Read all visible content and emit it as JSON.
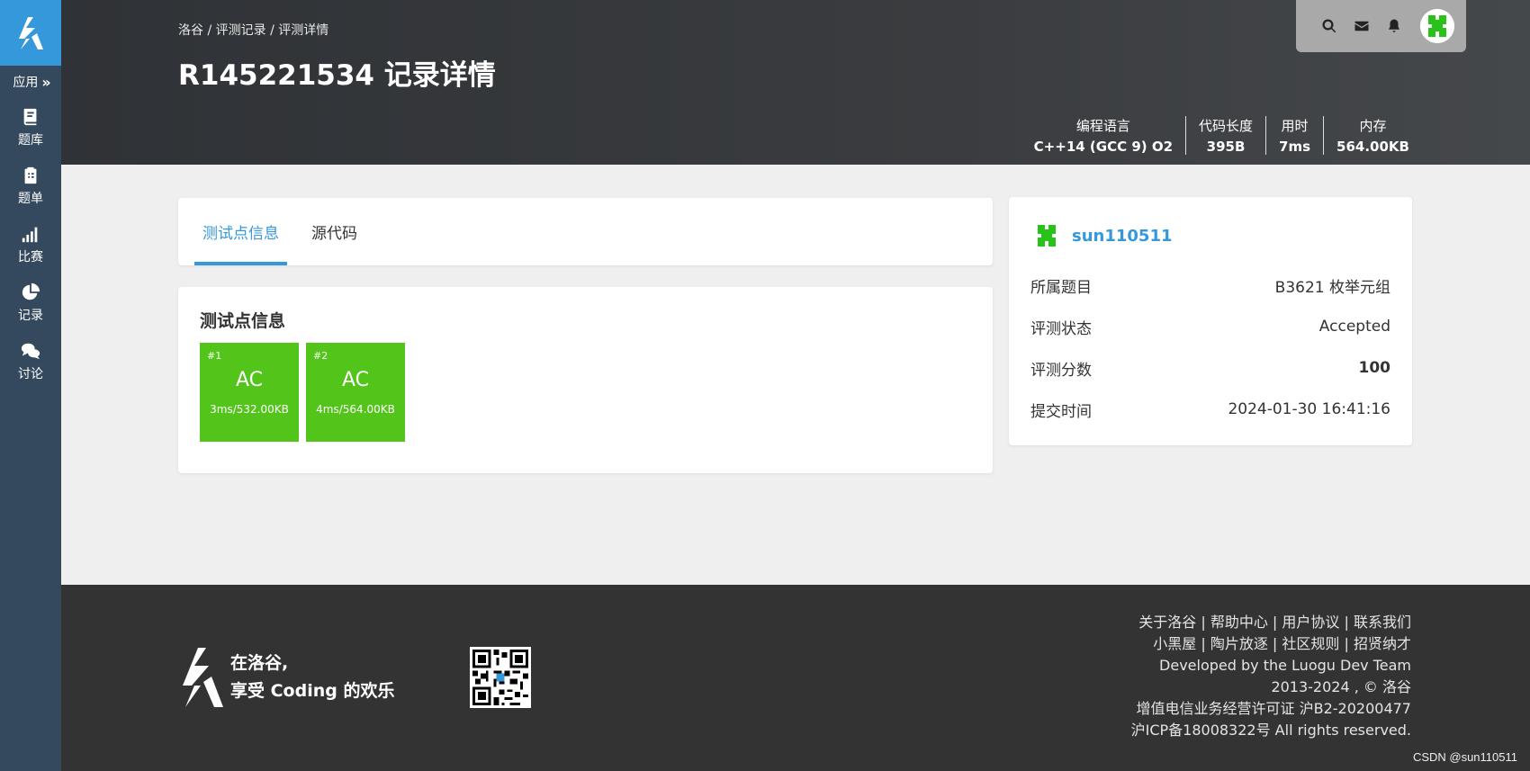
{
  "sidebar": {
    "apps_label": "应用",
    "items": [
      {
        "label": "题库",
        "icon": "book-icon"
      },
      {
        "label": "题单",
        "icon": "clipboard-icon"
      },
      {
        "label": "比赛",
        "icon": "signal-bars-icon"
      },
      {
        "label": "记录",
        "icon": "pie-chart-icon"
      },
      {
        "label": "讨论",
        "icon": "comments-icon"
      }
    ]
  },
  "header": {
    "breadcrumb": [
      "洛谷",
      "评测记录",
      "评测详情"
    ],
    "breadcrumb_sep": " / ",
    "title": "R145221534 记录详情",
    "stats": [
      {
        "label": "编程语言",
        "value": "C++14 (GCC 9) O2"
      },
      {
        "label": "代码长度",
        "value": "395B"
      },
      {
        "label": "用时",
        "value": "7ms"
      },
      {
        "label": "内存",
        "value": "564.00KB"
      }
    ]
  },
  "tabs": [
    "测试点信息",
    "源代码"
  ],
  "tests": {
    "heading": "测试点信息",
    "cases": [
      {
        "num": "#1",
        "result": "AC",
        "meta": "3ms/532.00KB"
      },
      {
        "num": "#2",
        "result": "AC",
        "meta": "4ms/564.00KB"
      }
    ]
  },
  "info": {
    "username": "sun110511",
    "rows": [
      {
        "label": "所属题目",
        "value": "B3621 枚举元组"
      },
      {
        "label": "评测状态",
        "value": "Accepted"
      },
      {
        "label": "评测分数",
        "value": "100"
      },
      {
        "label": "提交时间",
        "value": "2024-01-30 16:41:16"
      }
    ]
  },
  "footer": {
    "slogan_line1": "在洛谷,",
    "slogan_line2": "享受 Coding 的欢乐",
    "links_row1": [
      "关于洛谷",
      "帮助中心",
      "用户协议",
      "联系我们"
    ],
    "links_row2": [
      "小黑屋",
      "陶片放逐",
      "社区规则",
      "招贤纳才"
    ],
    "link_sep": " | ",
    "developed_prefix": "Developed by the ",
    "team": "Luogu Dev Team",
    "copyright": "2013-2024 , © 洛谷",
    "license": "增值电信业务经营许可证 沪B2-20200477",
    "icp": "沪ICP备18008322号 All rights reserved."
  },
  "watermark": "CSDN @sun110511",
  "colors": {
    "accent": "#3498db",
    "sidebar": "#34495e",
    "ac_green": "#52c41a",
    "footer": "#333333"
  }
}
